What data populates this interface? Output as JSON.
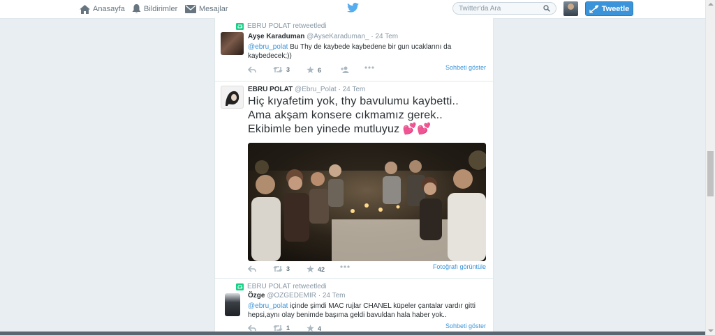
{
  "nav": {
    "home": "Anasayfa",
    "notifications": "Bildirimler",
    "messages": "Mesajlar"
  },
  "search": {
    "placeholder": "Twitter'da Ara"
  },
  "tweet_button": "Tweetle",
  "colors": {
    "accent": "#3b94d9",
    "retweet_green": "#19cf86",
    "background": "#e8eef2"
  },
  "tweets": [
    {
      "context": "EBRU POLAT retweetledi",
      "fullname": "Ayşe Karaduman",
      "username": "@AyseKaraduman_",
      "sep": "·",
      "time": "24 Tem",
      "mention": "@ebru_polat",
      "text": " Bu Thy de kaybede kaybedene bir gun ucaklarını da kaybedecek;))",
      "retweets": "3",
      "favorites": "6",
      "expand": "Sohbeti göster"
    },
    {
      "fullname": "EBRU POLAT",
      "username": "@Ebru_Polat",
      "sep": "·",
      "time": "24 Tem",
      "text_line1": "Hiç kıyafetim yok, thy bavulumu kaybetti..",
      "text_line2": "Ama akşam konsere cıkmamız gerek..",
      "text_line3": "Ekibimle ben yinede mutluyuz",
      "emoji": "💕💕",
      "retweets": "3",
      "favorites": "42",
      "expand": "Fotoğrafı görüntüle"
    },
    {
      "context": "EBRU POLAT retweetledi",
      "fullname": "Özge",
      "username": "@OZGEDEMIR",
      "sep": "·",
      "time": "24 Tem",
      "mention": "@ebru_polat",
      "text": "  içinde şimdi MAC rujlar CHANEL küpeler çantalar vardır gitti hepsi,aynı olay benimde başıma geldi bavuldan hala haber yok..",
      "retweets": "1",
      "favorites": "4",
      "expand": "Sohbeti göster"
    }
  ]
}
